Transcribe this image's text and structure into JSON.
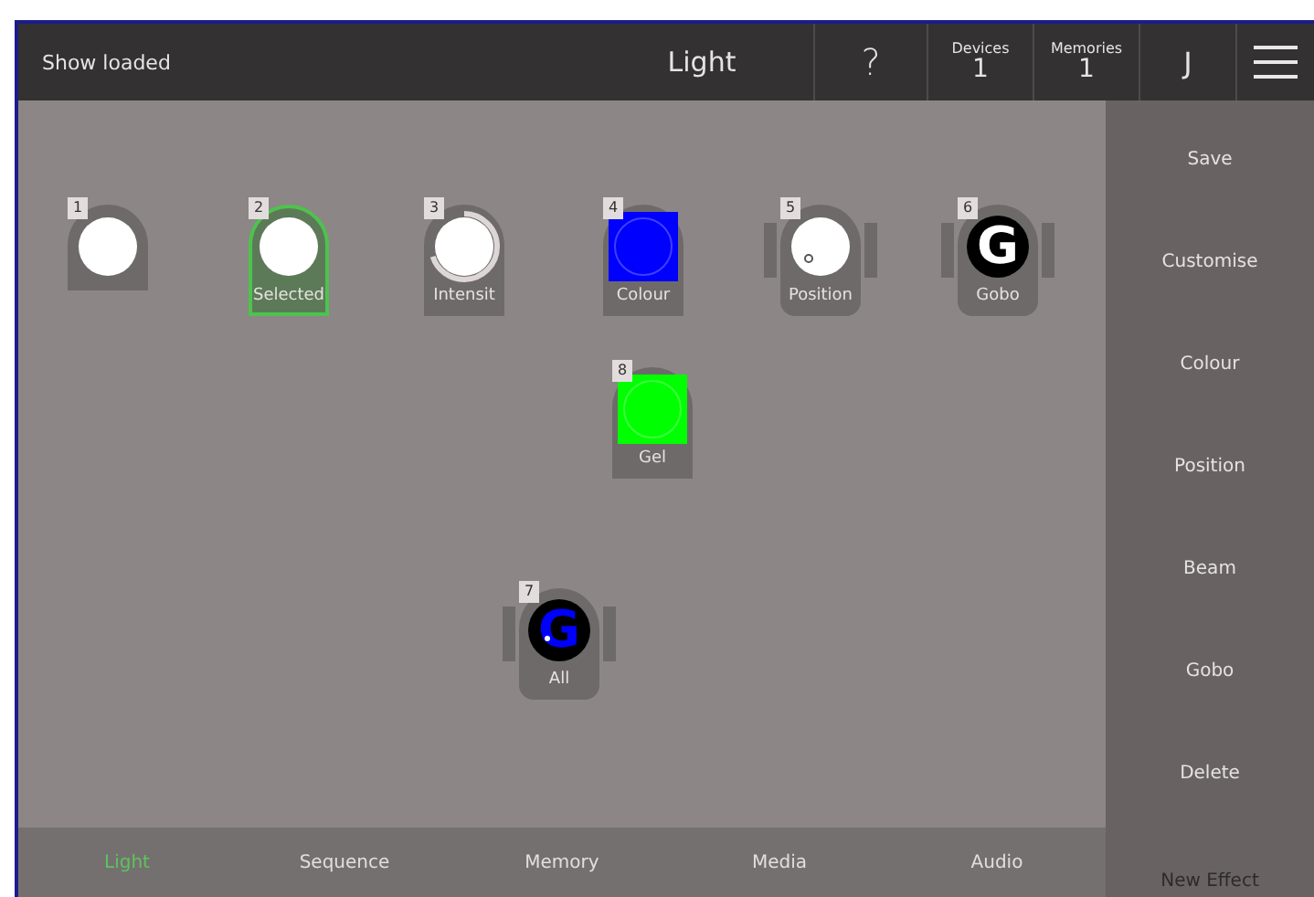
{
  "header": {
    "status": "Show loaded",
    "title": "Light",
    "help": "?",
    "counters": [
      {
        "label": "Devices",
        "value": "1"
      },
      {
        "label": "Memories",
        "value": "1"
      }
    ],
    "user": "J"
  },
  "fixtures": [
    {
      "number": "1",
      "kind": "fixed",
      "head": {
        "kind": "plain"
      },
      "selected": false
    },
    {
      "number": "2",
      "label": "Selected",
      "kind": "fixed",
      "head": {
        "kind": "plain"
      },
      "selected": true
    },
    {
      "number": "3",
      "label": "Intensit",
      "kind": "fixed",
      "head": {
        "kind": "intensity",
        "level": 0.7
      },
      "selected": false
    },
    {
      "number": "4",
      "label": "Colour",
      "kind": "fixed",
      "head": {
        "kind": "colour",
        "color": "#0000ff"
      },
      "selected": false
    },
    {
      "number": "5",
      "label": "Position",
      "kind": "moving",
      "head": {
        "kind": "position"
      },
      "selected": false
    },
    {
      "number": "6",
      "label": "Gobo",
      "kind": "moving",
      "head": {
        "kind": "gobo",
        "glyph": "G",
        "color": "#ffffff"
      },
      "selected": false
    },
    {
      "number": "8",
      "label": "Gel",
      "kind": "fixed",
      "head": {
        "kind": "colour",
        "color": "#00ff00"
      },
      "selected": false
    },
    {
      "number": "7",
      "label": "All",
      "kind": "moving",
      "head": {
        "kind": "gobo",
        "glyph": "G",
        "color": "#0000ff"
      },
      "selected": false
    }
  ],
  "sidebar": {
    "items": [
      {
        "label": "Save",
        "disabled": false
      },
      {
        "label": "Customise",
        "disabled": false
      },
      {
        "label": "Colour",
        "disabled": false
      },
      {
        "label": "Position",
        "disabled": false
      },
      {
        "label": "Beam",
        "disabled": false
      },
      {
        "label": "Gobo",
        "disabled": false
      },
      {
        "label": "Delete",
        "disabled": false
      },
      {
        "label": "New Effect",
        "disabled": true
      }
    ]
  },
  "tabs": [
    {
      "label": "Light",
      "selected": true
    },
    {
      "label": "Sequence",
      "selected": false
    },
    {
      "label": "Memory",
      "selected": false
    },
    {
      "label": "Media",
      "selected": false
    },
    {
      "label": "Audio",
      "selected": false
    }
  ]
}
